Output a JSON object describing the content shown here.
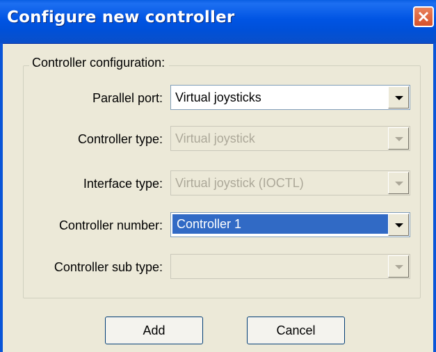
{
  "window": {
    "title": "Configure new controller"
  },
  "group": {
    "legend": "Controller configuration:"
  },
  "fields": [
    {
      "label": "Parallel port:",
      "value": "Virtual joysticks",
      "enabled": true,
      "selected": false
    },
    {
      "label": "Controller type:",
      "value": "Virtual joystick",
      "enabled": false,
      "selected": false
    },
    {
      "label": "Interface type:",
      "value": "Virtual joystick (IOCTL)",
      "enabled": false,
      "selected": false
    },
    {
      "label": "Controller number:",
      "value": "Controller 1",
      "enabled": true,
      "selected": true
    },
    {
      "label": "Controller sub type:",
      "value": "",
      "enabled": false,
      "selected": false
    }
  ],
  "buttons": {
    "add": "Add",
    "cancel": "Cancel"
  },
  "colors": {
    "titlebar": "#0054e3",
    "selection": "#316ac5",
    "face": "#ece9d8"
  }
}
